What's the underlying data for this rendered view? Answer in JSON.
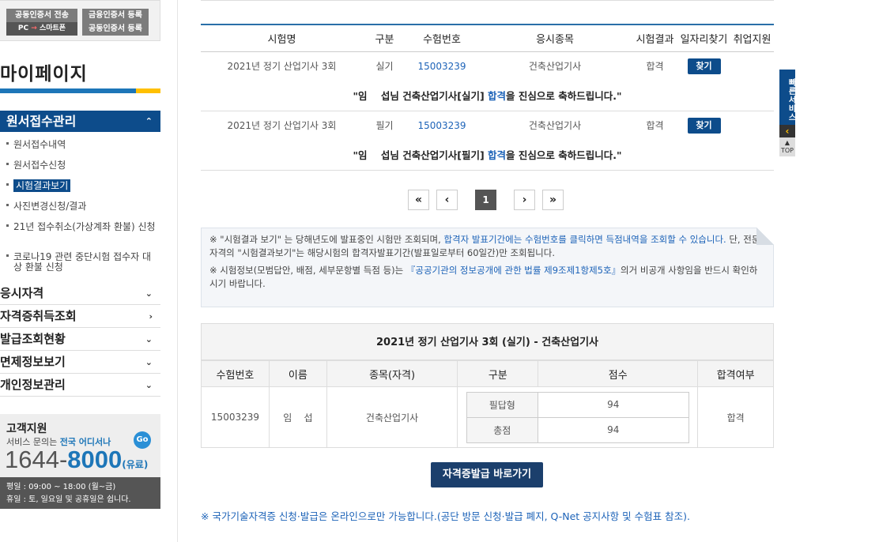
{
  "sidebar": {
    "cert": {
      "send_label": "공동인증서 전송",
      "pc_label": "PC",
      "smart_label": "스마트폰",
      "finance_label": "금융인증서 등록",
      "joint_label": "공동인증서 등록"
    },
    "mypage_title": "마이페이지",
    "active_menu": {
      "label": "원서접수관리"
    },
    "sub_items": [
      {
        "label": "원서접수내역"
      },
      {
        "label": "원서접수신청"
      },
      {
        "label": "시험결과보기"
      },
      {
        "label": "사진변경신청/결과"
      },
      {
        "label": "21년 접수취소(가상계좌 환불) 신청"
      },
      {
        "label": "코로나19 관련 중단시험 접수자 대상 환불 신청"
      }
    ],
    "menus": [
      {
        "label": "응시자격"
      },
      {
        "label": "자격증취득조회"
      },
      {
        "label": "발급조회현황"
      },
      {
        "label": "면제정보보기"
      },
      {
        "label": "개인정보관리"
      }
    ],
    "customer": {
      "title": "고객지원",
      "desc_prefix": "서비스 문의는",
      "desc_highlight": "전국 어디서나",
      "go": "Go",
      "phone_a": "1644",
      "phone_dash": "-",
      "phone_b": "8000",
      "phone_paid": "(유료)",
      "hours_1": "평일 : 09:00 ~ 18:00 (월~금)",
      "hours_2": "휴일 : 토, 일요일 및 공휴일은 쉽니다."
    }
  },
  "results": {
    "headers": [
      "시험명",
      "구분",
      "수험번호",
      "응시종목",
      "시험결과",
      "일자리찾기",
      "취업지원"
    ],
    "rows": [
      {
        "exam": "2021년 정기 산업기사 3회",
        "type": "실기",
        "number": "15003239",
        "subject": "건축산업기사",
        "result": "합격",
        "find": "찾기",
        "msg_pre": "\"임    섭님 건축산업기사[실기] ",
        "msg_hl": "합격",
        "msg_post": "을 진심으로 축하드립니다.\""
      },
      {
        "exam": "2021년 정기 산업기사 3회",
        "type": "필기",
        "number": "15003239",
        "subject": "건축산업기사",
        "result": "합격",
        "find": "찾기",
        "msg_pre": "\"임    섭님 건축산업기사[필기] ",
        "msg_hl": "합격",
        "msg_post": "을 진심으로 축하드립니다.\""
      }
    ]
  },
  "pager": {
    "first": "«",
    "prev": "‹",
    "current": "1",
    "next": "›",
    "last": "»"
  },
  "notice": {
    "line1_a": "※ \"시험결과 보기\" 는 당해년도에 발표중인 시험만 조회되며, ",
    "line1_b": "합격자 발표기간에는 수험번호를 클릭하면 득점내역을 조회할 수 있습니다.",
    "line1_c": " 단, 전문자격의 \"시험결과보기\"는 해당시험의 합격자발표기간(발표일로부터 60일간)만 조회됩니다.",
    "line2_a": "※ 시험정보(모범답안, 배점, 세부문항별 득점 등)는 ",
    "line2_b": "『공공기관의 정보공개에 관한 법률 제9조제1항제5호』",
    "line2_c": "의거 비공개 사항임을 반드시 확인하시기 바랍니다."
  },
  "score": {
    "title": "2021년 정기 산업기사 3회 (실기) - 건축산업기사",
    "headers": [
      "수험번호",
      "이름",
      "종목(자격)",
      "구분",
      "점수",
      "합격여부"
    ],
    "number": "15003239",
    "name": "임    섭",
    "subject": "건축산업기사",
    "parts": [
      {
        "label": "필답형",
        "score": "94"
      },
      {
        "label": "총점",
        "score": "94"
      }
    ],
    "pass": "합격"
  },
  "issue_button": "자격증발급 바로가기",
  "footnote": "※ 국가기술자격증 신청·발급은 온라인으로만 가능합니다.(공단 방문 신청·발급 폐지, Q-Net 공지사항 및 수험표 참조).",
  "quick": {
    "label": "빠른서비스",
    "arrow": "‹",
    "top": "TOP"
  }
}
